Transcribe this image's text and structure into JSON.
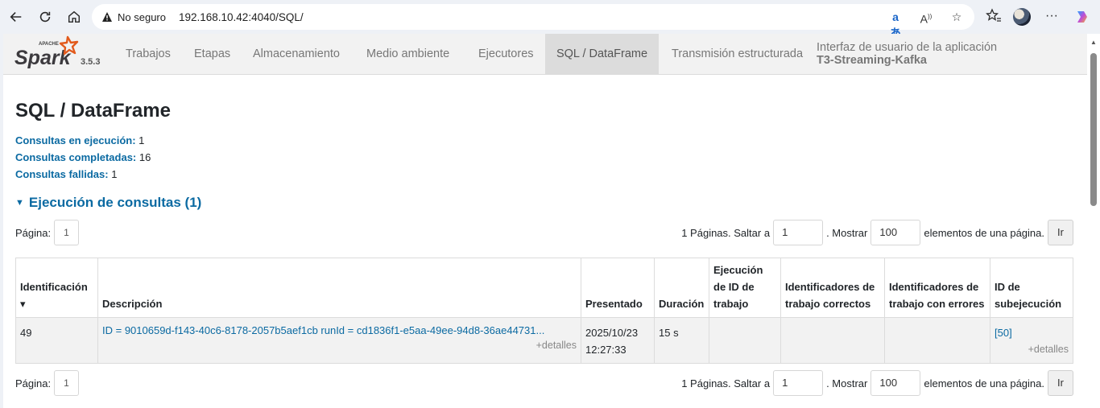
{
  "browser": {
    "insecure_label": "No seguro",
    "url": "192.168.10.42:4040/SQL/"
  },
  "spark": {
    "logo_small": "APACHE",
    "logo_word": "Spark",
    "version": "3.5.3",
    "tabs": [
      {
        "label": "Trabajos"
      },
      {
        "label": "Etapas"
      },
      {
        "label": "Almacenamiento"
      },
      {
        "label": "Medio ambiente"
      },
      {
        "label": "Ejecutores"
      },
      {
        "label": "SQL / DataFrame",
        "active": true
      },
      {
        "label": "Transmisión estructurada"
      }
    ],
    "app_title_prefix": "Interfaz de usuario de la aplicación",
    "app_name": "T3-Streaming-Kafka"
  },
  "page": {
    "title": "SQL / DataFrame",
    "summary": [
      {
        "key": "Consultas en ejecución:",
        "value": "1"
      },
      {
        "key": "Consultas completadas:",
        "value": "16"
      },
      {
        "key": "Consultas fallidas:",
        "value": "1"
      }
    ],
    "section_title": "Ejecución de consultas (1)"
  },
  "pager": {
    "page_label": "Página:",
    "page_value": "1",
    "pages_text": "1 Páginas. Saltar a",
    "jump_value": "1",
    "show_text": ". Mostrar",
    "size_value": "100",
    "per_page_text": "elementos de una página.",
    "go_label": "Ir"
  },
  "table": {
    "headers": [
      "Identificación ▾",
      "Descripción",
      "Presentado",
      "Duración",
      "Ejecución de ID de trabajo",
      "Identificadores de trabajo correctos",
      "Identificadores de trabajo con errores",
      "ID de subejecución"
    ],
    "rows": [
      {
        "id": "49",
        "description": "ID = 9010659d-f143-40c6-8178-2057b5aef1cb runId = cd1836f1-e5aa-49ee-94d8-36ae44731...",
        "details": "+detalles",
        "submitted_date": "2025/10/23",
        "submitted_time": "12:27:33",
        "duration": "15 s",
        "running_jobs": "",
        "succeeded_jobs": "",
        "failed_jobs": "",
        "sub_execution": "[50]",
        "sub_details": "+detalles"
      }
    ]
  },
  "colors": {
    "link": "#0b6aa2",
    "nav_bg": "#f2f2f2",
    "active_tab": "#dcdcdc",
    "row_bg": "#f2f2f2"
  }
}
